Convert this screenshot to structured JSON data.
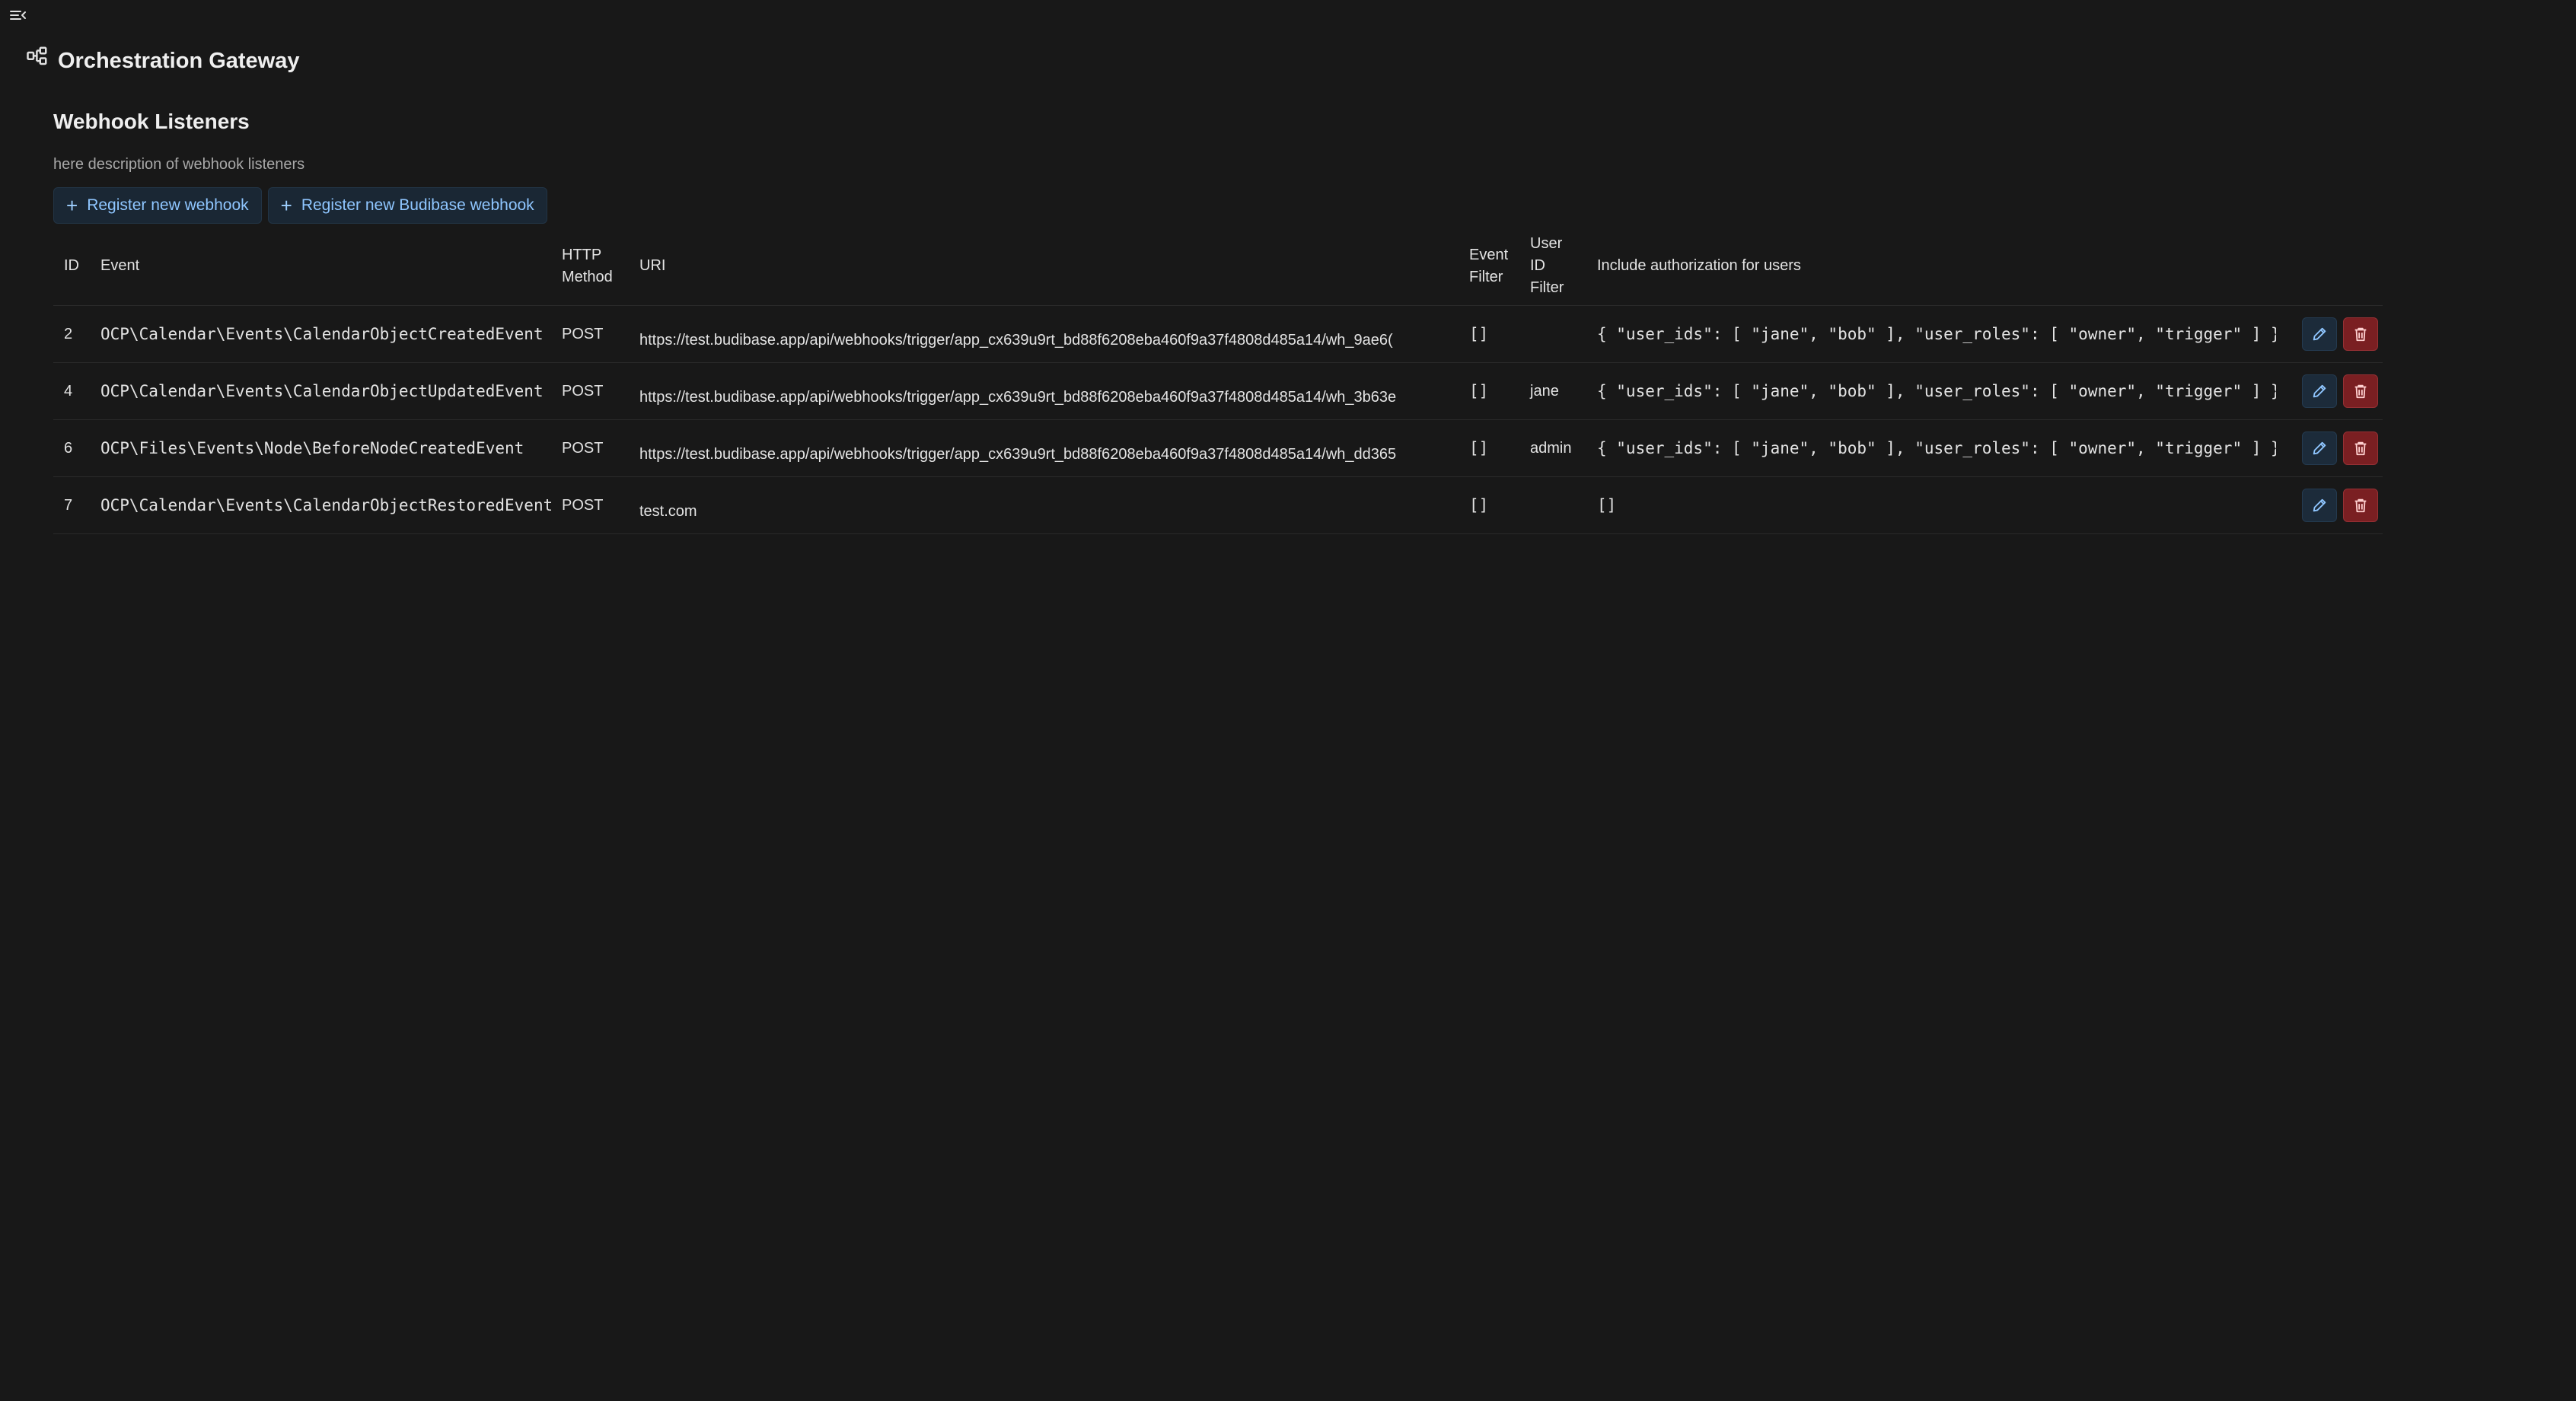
{
  "app": {
    "title": "Orchestration Gateway",
    "menu_icon": "menu-collapse-icon",
    "app_icon": "flow-diagram-icon"
  },
  "section": {
    "title": "Webhook Listeners",
    "description": "here description of webhook listeners"
  },
  "actions": {
    "register_webhook": "Register new webhook",
    "register_budibase_webhook": "Register new Budibase webhook",
    "plus_glyph": "+"
  },
  "table": {
    "headers": {
      "id": "ID",
      "event": "Event",
      "http_method_line1": "HTTP",
      "http_method_line2": "Method",
      "uri": "URI",
      "event_filter_line1": "Event",
      "event_filter_line2": "Filter",
      "user_id_filter_line1": "User",
      "user_id_filter_line2": "ID",
      "user_id_filter_line3": "Filter",
      "auth": "Include authorization for users"
    },
    "rows": [
      {
        "id": "2",
        "event": "OCP\\Calendar\\Events\\CalendarObjectCreatedEvent",
        "method": "POST",
        "uri": "https://test.budibase.app/api/webhooks/trigger/app_cx639u9rt_bd88f6208eba460f9a37f4808d485a14/wh_9ae6(",
        "event_filter": "[]",
        "user_id_filter": "",
        "auth": "{ \"user_ids\": [ \"jane\", \"bob\" ], \"user_roles\": [ \"owner\", \"trigger\" ] }"
      },
      {
        "id": "4",
        "event": "OCP\\Calendar\\Events\\CalendarObjectUpdatedEvent",
        "method": "POST",
        "uri": "https://test.budibase.app/api/webhooks/trigger/app_cx639u9rt_bd88f6208eba460f9a37f4808d485a14/wh_3b63e",
        "event_filter": "[]",
        "user_id_filter": "jane",
        "auth": "{ \"user_ids\": [ \"jane\", \"bob\" ], \"user_roles\": [ \"owner\", \"trigger\" ] }"
      },
      {
        "id": "6",
        "event": "OCP\\Files\\Events\\Node\\BeforeNodeCreatedEvent",
        "method": "POST",
        "uri": "https://test.budibase.app/api/webhooks/trigger/app_cx639u9rt_bd88f6208eba460f9a37f4808d485a14/wh_dd365",
        "event_filter": "[]",
        "user_id_filter": "admin",
        "auth": "{ \"user_ids\": [ \"jane\", \"bob\" ], \"user_roles\": [ \"owner\", \"trigger\" ] }"
      },
      {
        "id": "7",
        "event": "OCP\\Calendar\\Events\\CalendarObjectRestoredEvent",
        "method": "POST",
        "uri": "test.com",
        "event_filter": "[]",
        "user_id_filter": "",
        "auth": "[]"
      }
    ],
    "row_action_icons": [
      "pencil-icon",
      "trash-icon"
    ]
  },
  "colors": {
    "background": "#181818",
    "accent": "#8fc6ff",
    "button_bg": "#1a2734",
    "delete_bg": "#7a1f22"
  }
}
